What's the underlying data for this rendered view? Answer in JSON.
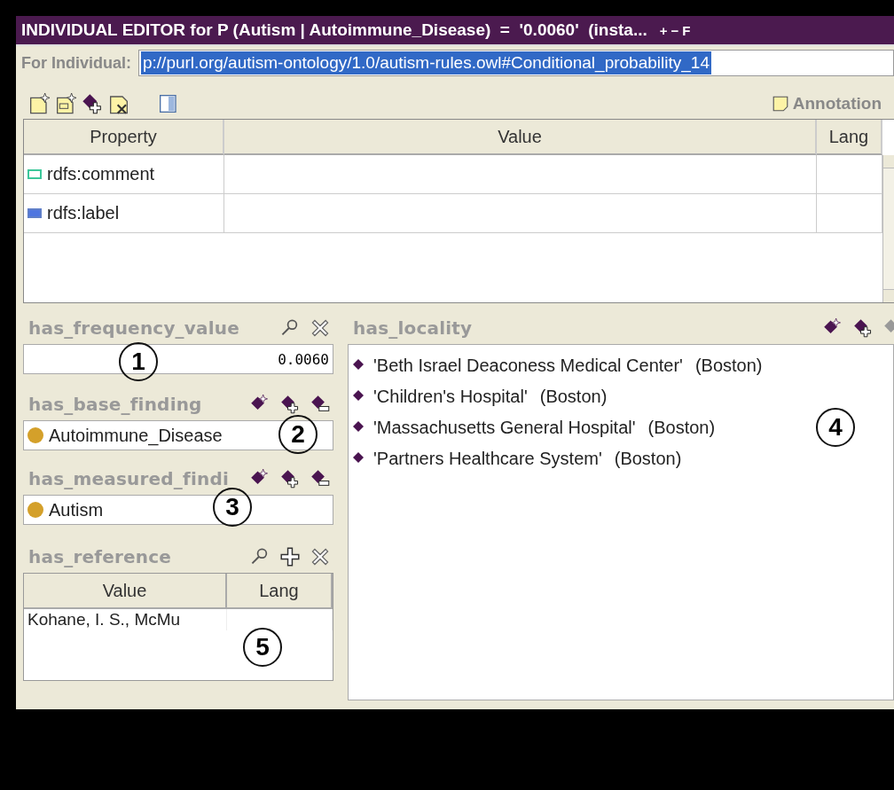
{
  "window": {
    "title": "INDIVIDUAL EDITOR for P (Autism | Autoimmune_Disease)  =  '0.0060'  (insta...",
    "title_buttons": [
      "+",
      "−",
      "F"
    ]
  },
  "individual": {
    "label": "For Individual:",
    "value": "p://purl.org/autism-ontology/1.0/autism-rules.owl#Conditional_probability_14",
    "selected": true
  },
  "toolbar": {
    "tools": [
      {
        "kind": "new-doc"
      },
      {
        "kind": "dc-doc"
      },
      {
        "kind": "diamond-plus"
      },
      {
        "kind": "doc-delete"
      },
      {
        "kind": "panel"
      }
    ],
    "annotations_button": "Annotation"
  },
  "annotations_table": {
    "columns": [
      "Property",
      "Value",
      "Lang"
    ],
    "rows": [
      {
        "property": "rdfs:comment",
        "kind": "comment"
      },
      {
        "property": "rdfs:label",
        "kind": "label"
      }
    ]
  },
  "left_slots": [
    {
      "name": "has_frequency_value",
      "kind": "value",
      "tools": [
        {
          "kind": "search"
        },
        {
          "kind": "delete"
        }
      ],
      "value": "0.0060",
      "callout": "1"
    },
    {
      "name": "has_base_finding",
      "kind": "instances",
      "tools": [
        {
          "kind": "diamond-star"
        },
        {
          "kind": "diamond-plus"
        },
        {
          "kind": "diamond-minus"
        }
      ],
      "items": [
        "Autoimmune_Disease"
      ],
      "callout": "2"
    },
    {
      "name": "has_measured_findi",
      "kind": "instances",
      "tools": [
        {
          "kind": "diamond-star"
        },
        {
          "kind": "diamond-plus"
        },
        {
          "kind": "diamond-minus"
        }
      ],
      "items": [
        "Autism"
      ],
      "callout": "3"
    },
    {
      "name": "has_reference",
      "kind": "table",
      "tools": [
        {
          "kind": "search"
        },
        {
          "kind": "plus"
        },
        {
          "kind": "delete"
        }
      ],
      "columns": [
        "Value",
        "Lang"
      ],
      "rows": [
        [
          "Kohane, I. S., McMu"
        ]
      ],
      "callout": "5"
    }
  ],
  "locality": {
    "name": "has_locality",
    "tools": [
      {
        "kind": "diamond-star"
      },
      {
        "kind": "diamond-plus"
      },
      {
        "kind": "diamond-grey"
      }
    ],
    "items": [
      {
        "name": "'Beth Israel Deaconess Medical Center'",
        "city": "(Boston)"
      },
      {
        "name": "'Children's Hospital'",
        "city": "(Boston)"
      },
      {
        "name": "'Massachusetts General Hospital'",
        "city": "(Boston)"
      },
      {
        "name": "'Partners Healthcare System'",
        "city": "(Boston)"
      }
    ],
    "callout": "4"
  }
}
